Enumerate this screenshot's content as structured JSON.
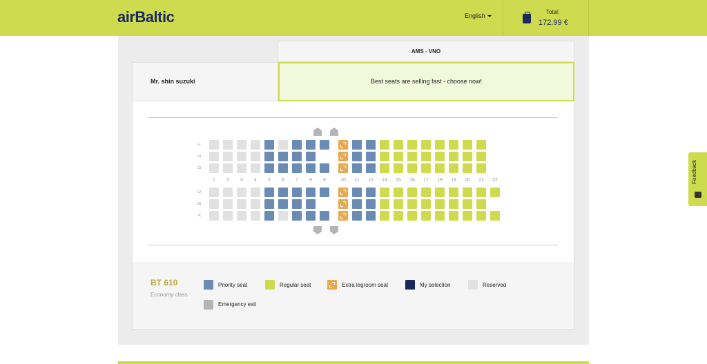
{
  "header": {
    "logo": "airBaltic",
    "language": "English",
    "total_label": "Total:",
    "total_value": "172.99 €"
  },
  "route": "AMS - VNO",
  "passenger": {
    "name": "Mr. shin suzuki"
  },
  "notice": "Best seats are selling fast - choose now!",
  "seatmap": {
    "columns_top": [
      "F",
      "E",
      "D"
    ],
    "columns_bottom": [
      "C",
      "B",
      "A"
    ],
    "rows": [
      "1",
      "2",
      "3",
      "4",
      "5",
      "6",
      "7",
      "8",
      "9",
      "10",
      "11",
      "12",
      "14",
      "15",
      "16",
      "17",
      "18",
      "19",
      "20",
      "21",
      "22"
    ],
    "seats": {
      "F": [
        "reserved",
        "reserved",
        "reserved",
        "reserved",
        "priority",
        "reserved",
        "priority",
        "priority",
        "priority",
        "legroom",
        "priority",
        "priority",
        "regular",
        "regular",
        "regular",
        "regular",
        "regular",
        "regular",
        "regular",
        "regular",
        ""
      ],
      "E": [
        "reserved",
        "reserved",
        "reserved",
        "reserved",
        "priority",
        "priority",
        "priority",
        "priority",
        "",
        "legroom",
        "priority",
        "priority",
        "regular",
        "regular",
        "regular",
        "regular",
        "regular",
        "regular",
        "regular",
        "regular",
        ""
      ],
      "D": [
        "reserved",
        "reserved",
        "reserved",
        "reserved",
        "priority",
        "priority",
        "priority",
        "priority",
        "priority",
        "legroom",
        "priority",
        "priority",
        "regular",
        "regular",
        "regular",
        "regular",
        "regular",
        "regular",
        "regular",
        "regular",
        ""
      ],
      "C": [
        "reserved",
        "reserved",
        "reserved",
        "reserved",
        "priority",
        "priority",
        "priority",
        "priority",
        "priority",
        "legroom",
        "priority",
        "priority",
        "regular",
        "regular",
        "regular",
        "regular",
        "regular",
        "regular",
        "regular",
        "regular",
        "regular"
      ],
      "B": [
        "reserved",
        "reserved",
        "reserved",
        "reserved",
        "priority",
        "priority",
        "priority",
        "priority",
        "",
        "legroom",
        "priority",
        "priority",
        "regular",
        "regular",
        "regular",
        "regular",
        "regular",
        "regular",
        "regular",
        "regular",
        ""
      ],
      "A": [
        "reserved",
        "reserved",
        "reserved",
        "reserved",
        "priority",
        "reserved",
        "priority",
        "priority",
        "priority",
        "legroom",
        "priority",
        "priority",
        "regular",
        "regular",
        "regular",
        "regular",
        "regular",
        "regular",
        "regular",
        "regular",
        "regular"
      ]
    }
  },
  "legend": {
    "flight_no": "BT 610",
    "flight_class": "Economy class",
    "items": [
      {
        "label": "Priority seat",
        "color": "#6a8bb3"
      },
      {
        "label": "Regular seat",
        "color": "#cfdb4e"
      },
      {
        "label": "Extra legroom seat",
        "color": "#e9a84e"
      },
      {
        "label": "My selection",
        "color": "#1b2a5c"
      },
      {
        "label": "Reserved",
        "color": "#e1e1e1"
      },
      {
        "label": "Emergency exit",
        "color": "#b5b5b5"
      }
    ]
  },
  "feedback": "Feedback"
}
